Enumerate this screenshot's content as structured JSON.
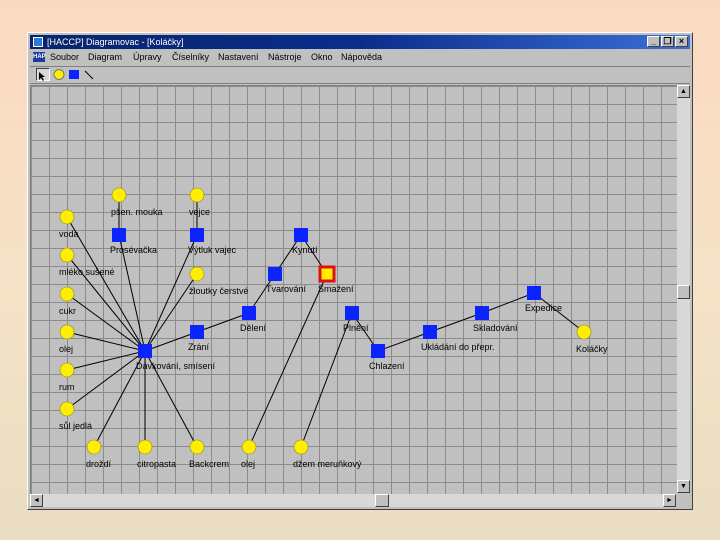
{
  "window": {
    "title": "[HACCP] Diagramovac - [Koláčky]",
    "buttons": {
      "minimize": "_",
      "restore": "❐",
      "close": "×"
    }
  },
  "menu": {
    "icon_text": "HAP",
    "items": [
      "Soubor",
      "Diagram",
      "Úpravy",
      "Číselníky",
      "Nastavení",
      "Nástroje",
      "Okno",
      "Nápověda"
    ]
  },
  "toolbar": {
    "tools": [
      "select-tool",
      "circle-tool",
      "square-tool",
      "line-tool"
    ],
    "colors": {
      "circle": "#ffee00",
      "square": "#0a23ff"
    }
  },
  "diagram": {
    "nodes": [
      {
        "id": "voda",
        "shape": "circle",
        "label": "voda"
      },
      {
        "id": "psenicna_mouka",
        "shape": "circle",
        "label": "pšen. mouka"
      },
      {
        "id": "vejce",
        "shape": "circle",
        "label": "vejce"
      },
      {
        "id": "mleko",
        "shape": "circle",
        "label": "mléko sušené"
      },
      {
        "id": "cukr",
        "shape": "circle",
        "label": "cukr"
      },
      {
        "id": "olej1",
        "shape": "circle",
        "label": "olej"
      },
      {
        "id": "rum",
        "shape": "circle",
        "label": "rum"
      },
      {
        "id": "sul",
        "shape": "circle",
        "label": "sůl jedlá"
      },
      {
        "id": "zloutky",
        "shape": "circle",
        "label": "žloutky čerstvé"
      },
      {
        "id": "drozdi",
        "shape": "circle",
        "label": "droždí"
      },
      {
        "id": "citropasta",
        "shape": "circle",
        "label": "citropasta"
      },
      {
        "id": "backcrem",
        "shape": "circle",
        "label": "Backcrem"
      },
      {
        "id": "olej2",
        "shape": "circle",
        "label": "olej"
      },
      {
        "id": "dzem",
        "shape": "circle",
        "label": "džem meruňkový"
      },
      {
        "id": "kolacky",
        "shape": "circle",
        "label": "Koláčky"
      },
      {
        "id": "presevacka",
        "shape": "square",
        "label": "Prosévačka"
      },
      {
        "id": "vytluk",
        "shape": "square",
        "label": "Výtluk vajec"
      },
      {
        "id": "kynuti",
        "shape": "square",
        "label": "Kynutí"
      },
      {
        "id": "tvarovani",
        "shape": "square",
        "label": "Tvarování"
      },
      {
        "id": "smazeni",
        "shape": "square-selected",
        "label": "Smažení"
      },
      {
        "id": "deleni",
        "shape": "square",
        "label": "Dělení"
      },
      {
        "id": "zrani",
        "shape": "square",
        "label": "Zrání"
      },
      {
        "id": "davkovani",
        "shape": "square",
        "label": "Dávkování, smísení"
      },
      {
        "id": "pleni",
        "shape": "square",
        "label": "Plnění"
      },
      {
        "id": "chlazeni",
        "shape": "square",
        "label": "Chlazení"
      },
      {
        "id": "ukladani",
        "shape": "square",
        "label": "Ukládání do přepr."
      },
      {
        "id": "skladovani",
        "shape": "square",
        "label": "Skladování"
      },
      {
        "id": "expedice",
        "shape": "square",
        "label": "Expedice"
      }
    ],
    "edges": [
      [
        "voda",
        "davkovani"
      ],
      [
        "mleko",
        "davkovani"
      ],
      [
        "cukr",
        "davkovani"
      ],
      [
        "olej1",
        "davkovani"
      ],
      [
        "rum",
        "davkovani"
      ],
      [
        "sul",
        "davkovani"
      ],
      [
        "psenicna_mouka",
        "presevacka"
      ],
      [
        "presevacka",
        "davkovani"
      ],
      [
        "vejce",
        "vytluk"
      ],
      [
        "vytluk",
        "davkovani"
      ],
      [
        "zloutky",
        "davkovani"
      ],
      [
        "drozdi",
        "davkovani"
      ],
      [
        "citropasta",
        "davkovani"
      ],
      [
        "backcrem",
        "davkovani"
      ],
      [
        "davkovani",
        "zrani"
      ],
      [
        "zrani",
        "deleni"
      ],
      [
        "deleni",
        "tvarovani"
      ],
      [
        "tvarovani",
        "kynuti"
      ],
      [
        "kynuti",
        "smazeni"
      ],
      [
        "smazeni",
        "olej2"
      ],
      [
        "dzem",
        "pleni"
      ],
      [
        "pleni",
        "chlazeni"
      ],
      [
        "chlazeni",
        "ukladani"
      ],
      [
        "ukladani",
        "skladovani"
      ],
      [
        "skladovani",
        "expedice"
      ],
      [
        "expedice",
        "kolacky"
      ]
    ]
  },
  "scroll": {
    "up": "▲",
    "down": "▼",
    "left": "◄",
    "right": "►"
  }
}
